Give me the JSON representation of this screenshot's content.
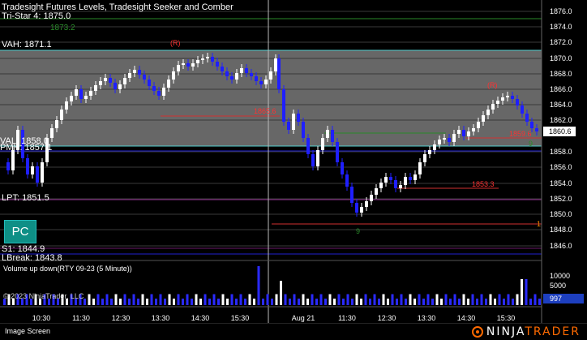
{
  "chart": {
    "title": "Tradesight Futures Levels, Tradesight Seeker and Comber",
    "levels": {
      "tristar": "Tri-Star 4: 1875.0",
      "tristar_alt": "1873.2",
      "vah": "VAH: 1871.1",
      "val": "VAL: 1858.0",
      "pmh": "PMH: 1857.1",
      "lpt": "LPT: 1851.5",
      "s1": "S1: 1844.9",
      "lbreak": "LBreak: 1843.8"
    },
    "price_tags": [
      "1865.6",
      "1853.3",
      "1859.6",
      "1"
    ],
    "signal_markers": [
      "(R)",
      "(R)",
      "9",
      "9"
    ],
    "current_price": "1860.6",
    "y_axis_labels": [
      "1876.0",
      "1874.0",
      "1872.0",
      "1870.0",
      "1868.0",
      "1866.0",
      "1864.0",
      "1862.0",
      "1858.0",
      "1856.0",
      "1854.0",
      "1852.0",
      "1850.0",
      "1848.0",
      "1846.0"
    ],
    "pc_button": "PC",
    "colors": {
      "up_bar": "#ffffff",
      "down_bar": "#1f1fff",
      "value_area": "#8a8a8a",
      "accent": "#ff6a00",
      "level_cyan": "#55d0d0",
      "level_red": "#d03030",
      "level_green": "#2a8a2a"
    }
  },
  "volume_panel": {
    "title": "Volume up down(RTY 09-23 (5 Minute))",
    "copyright": "© 2023 NinjaTrader, LLC",
    "y_labels": [
      "10000",
      "5000"
    ],
    "current_volume": "997"
  },
  "x_axis_labels": [
    "10:30",
    "11:30",
    "12:30",
    "13:30",
    "14:30",
    "15:30",
    "Aug 21",
    "11:30",
    "12:30",
    "13:30",
    "14:30",
    "15:30"
  ],
  "status_bar": {
    "label": "Image Screen",
    "logo": {
      "part1": "NINJA",
      "part2": "TRADER"
    }
  }
}
